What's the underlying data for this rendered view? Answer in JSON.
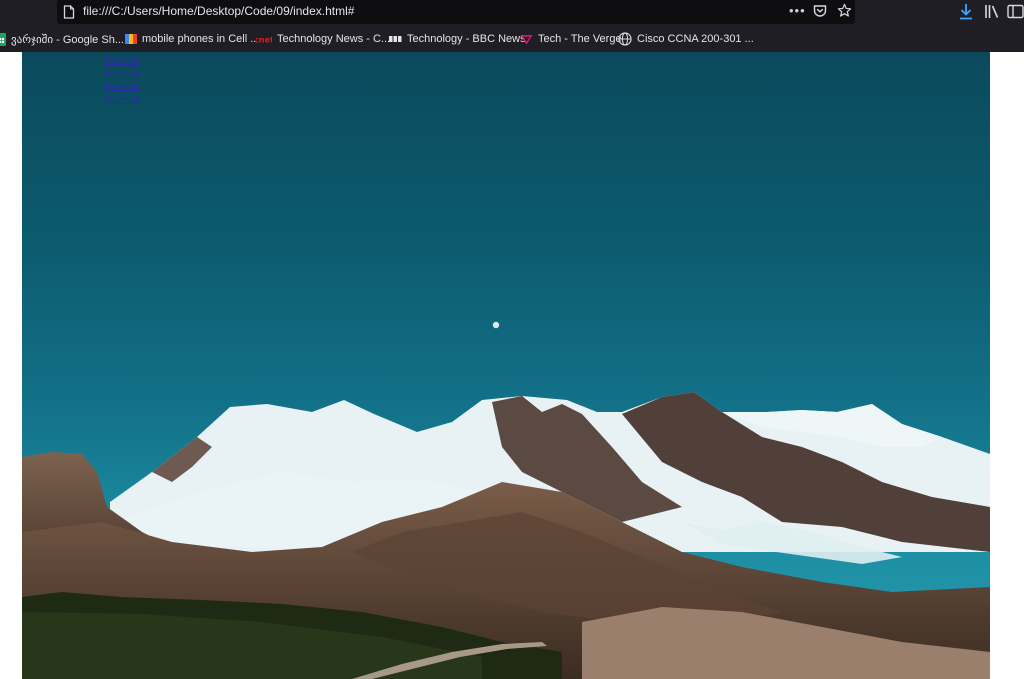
{
  "browser": {
    "url": "file:///C:/Users/Home/Desktop/Code/09/index.html#",
    "url_actions": [
      "more-icon",
      "pocket-icon",
      "star-icon"
    ],
    "toolbar_icons": [
      "download-icon",
      "library-icon",
      "sidebar-icon"
    ],
    "more_glyph": "•••"
  },
  "bookmarks": [
    {
      "label": "ვარჯიში - Google Sh...",
      "icon": "google-sheets-icon"
    },
    {
      "label": "mobile phones in Cell ...",
      "icon": "folder-icon"
    },
    {
      "label": "Technology News - C...",
      "icon": "cnet-icon"
    },
    {
      "label": "Technology - BBC News",
      "icon": "bbc-icon"
    },
    {
      "label": "Tech - The Verge",
      "icon": "verge-icon"
    },
    {
      "label": "Cisco CCNA 200-301 ...",
      "icon": "globe-icon"
    }
  ],
  "page": {
    "links": [
      {
        "label": "Facebook"
      },
      {
        "label": "Facebook"
      },
      {
        "label": "Facebook"
      },
      {
        "label": "Facebook"
      }
    ],
    "hero_image": "mountain-landscape",
    "colors": {
      "sky_top": "#0b4a5c",
      "sky_bottom": "#2a9bb0",
      "snow": "#e6f1f4",
      "rock": "#6b5142",
      "forest": "#1f2a14"
    }
  }
}
